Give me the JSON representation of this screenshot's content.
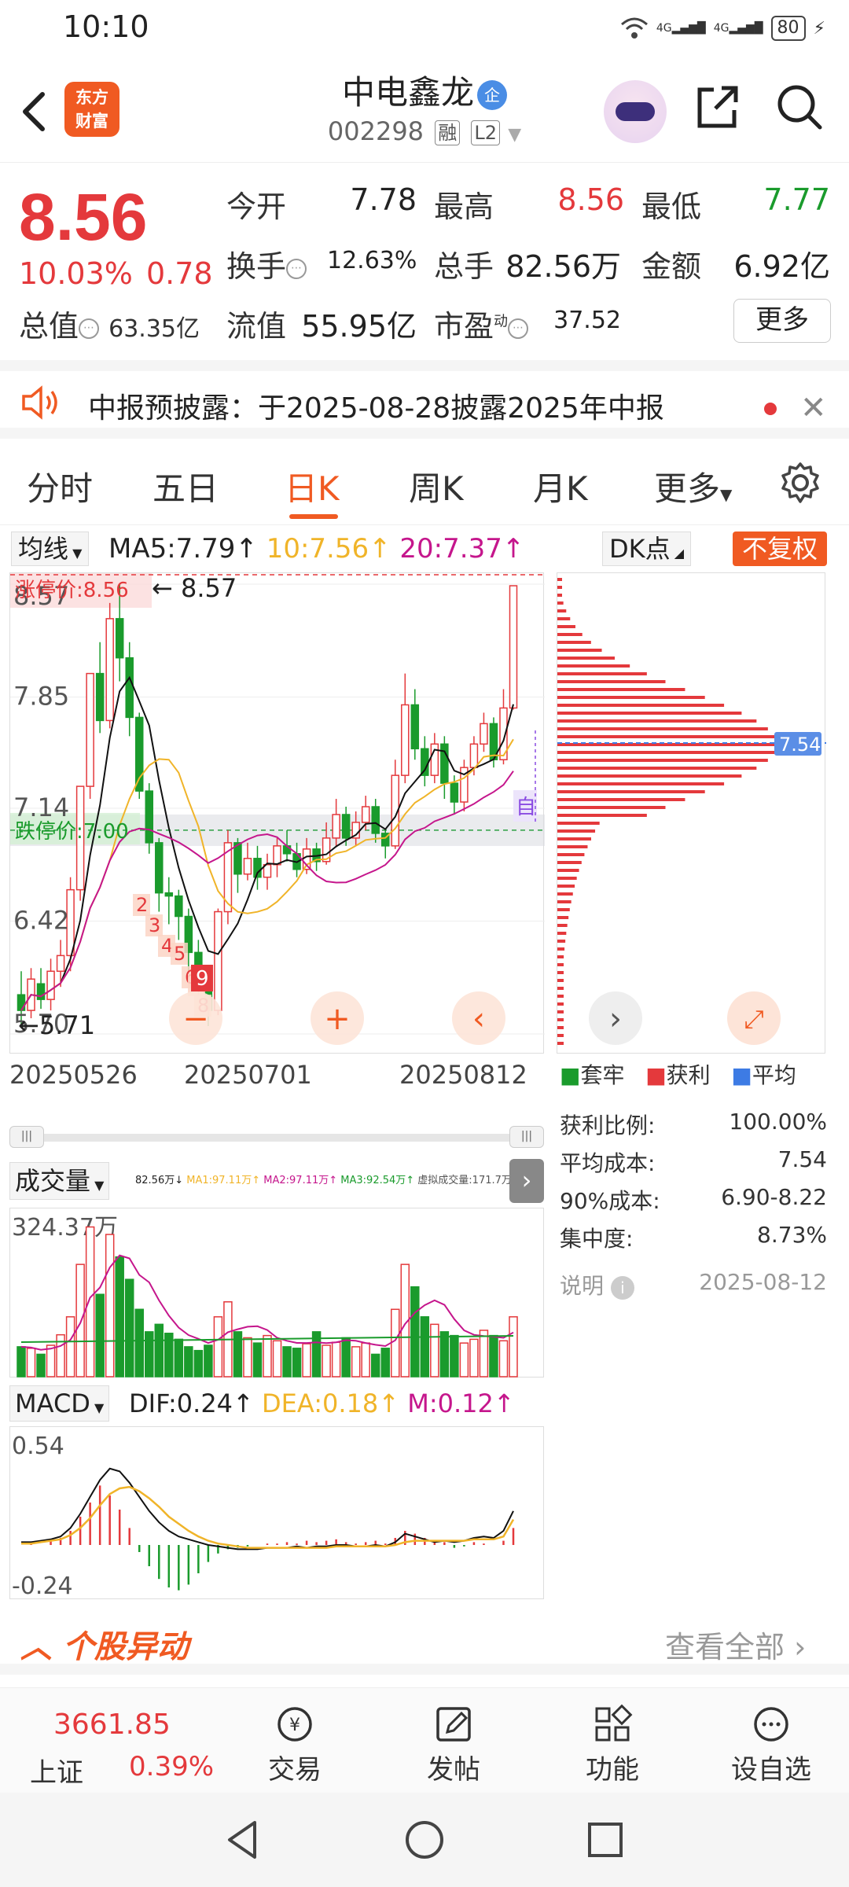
{
  "status_bar": {
    "time": "10:10",
    "network1": "4G",
    "network2": "4G",
    "battery": "80"
  },
  "header": {
    "logo_line1": "东方",
    "logo_line2": "财富",
    "stock_name": "中电鑫龙",
    "badge": "企",
    "stock_code": "002298",
    "tag_margin": "融",
    "tag_level": "L2"
  },
  "quote": {
    "price": "8.56",
    "change_pct": "10.03%",
    "change_val": "0.78",
    "open_label": "今开",
    "open": "7.78",
    "high_label": "最高",
    "high": "8.56",
    "low_label": "最低",
    "low": "7.77",
    "turnover_label": "换手",
    "turnover": "12.63%",
    "volume_label": "总手",
    "volume": "82.56万",
    "amount_label": "金额",
    "amount": "6.92亿",
    "mktcap_label": "总值",
    "mktcap": "63.35亿",
    "float_label": "流值",
    "float": "55.95亿",
    "pe_label": "市盈",
    "pe_sup": "动",
    "pe": "37.52",
    "more": "更多"
  },
  "notice": {
    "text": "中报预披露：于2025-08-28披露2025年中报"
  },
  "tabs": [
    "分时",
    "五日",
    "日K",
    "周K",
    "月K",
    "更多"
  ],
  "ma_bar": {
    "selector": "均线",
    "ma5": "MA5:7.79",
    "ma10": "10:7.56",
    "ma20": "20:7.37",
    "dk": "DK点",
    "adjust": "不复权"
  },
  "kchart": {
    "y_labels": [
      "8.57",
      "7.85",
      "7.14",
      "6.42",
      "5.70"
    ],
    "limit_up_label": "涨停价:8.56",
    "limit_down_label": "跌停价:7.00",
    "max_marker": "8.57",
    "min_marker": "5.71",
    "self_tag": "自",
    "dates": [
      "20250526",
      "20250701",
      "20250812"
    ],
    "seq": [
      "2",
      "3",
      "4",
      "5",
      "6",
      "7",
      "8",
      "9"
    ]
  },
  "chip": {
    "avg_label": "7.54",
    "legend": [
      "套牢",
      "获利",
      "平均"
    ],
    "rows": [
      {
        "label": "获利比例:",
        "value": "100.00%"
      },
      {
        "label": "平均成本:",
        "value": "7.54"
      },
      {
        "label": "90%成本:",
        "value": "6.90-8.22"
      },
      {
        "label": "集中度:",
        "value": "8.73%"
      }
    ],
    "note_label": "说明",
    "note_date": "2025-08-12"
  },
  "volume": {
    "selector": "成交量",
    "y_label": "324.37万",
    "v": "82.56万↓",
    "ma1": "MA1:97.11万↑",
    "ma2": "MA2:97.11万↑",
    "ma3": "MA3:92.54万↑",
    "virtual": "虚拟成交量:171.7万"
  },
  "macd": {
    "selector": "MACD",
    "dif": "DIF:0.24",
    "dea": "DEA:0.18",
    "m": "M:0.12",
    "y_top": "0.54",
    "y_bottom": "-0.24"
  },
  "anomaly": {
    "title": "个股异动",
    "view_all": "查看全部"
  },
  "bottom_nav": {
    "index_value": "3661.85",
    "index_name": "上证",
    "index_change": "0.39%",
    "items": [
      "交易",
      "发帖",
      "功能",
      "设自选"
    ]
  },
  "colors": {
    "up": "#e4393c",
    "down": "#1a9b2c",
    "accent": "#f05a22",
    "ma5": "#000000",
    "ma10": "#f0b429",
    "ma20": "#c5168c"
  }
}
